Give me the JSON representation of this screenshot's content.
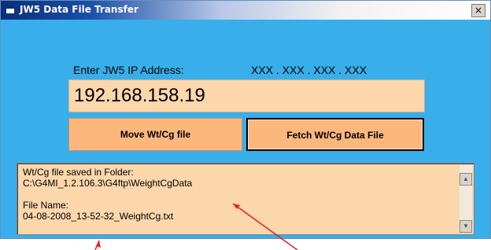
{
  "window": {
    "title": "JW5 Data File Transfer",
    "close_label": "×"
  },
  "ip": {
    "label": "Enter JW5 IP Address:",
    "mask": "XXX . XXX . XXX . XXX",
    "value": "192.168.158.19"
  },
  "buttons": {
    "move_label": "Move Wt/Cg file",
    "fetch_label": "Fetch Wt/Cg  Data File"
  },
  "status": {
    "text": "Wt/Cg file saved in Folder:\nC:\\G4MI_1.2.106.3\\G4ftp\\WeightCgData\n\nFile Name:\n04-08-2008_13-52-32_WeightCg.txt"
  },
  "scroll": {
    "up_icon": "scroll-up-arrow",
    "down_icon": "scroll-down-arrow"
  },
  "colors": {
    "window_bg": "#38aeea",
    "field_bg": "#fbd7ab",
    "button_bg": "#fcb77d",
    "annotation_arrow": "#e02020"
  }
}
